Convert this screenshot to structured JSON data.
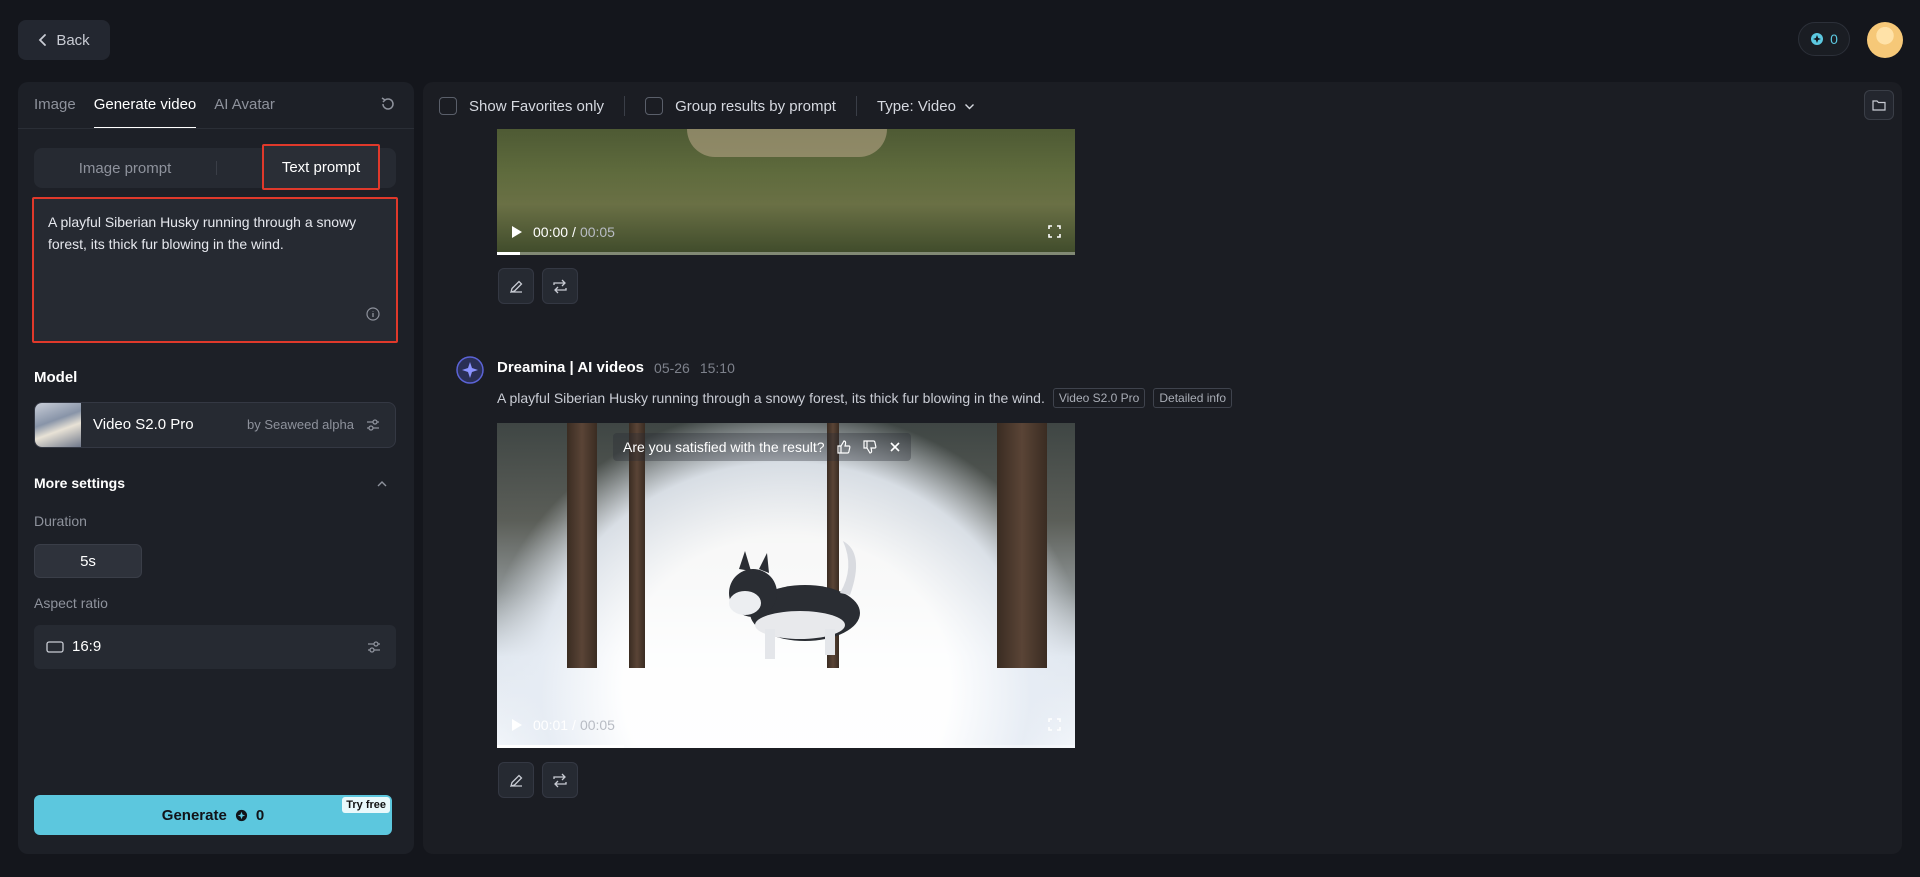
{
  "header": {
    "back_label": "Back",
    "credits": "0"
  },
  "sidebar": {
    "tabs": [
      {
        "label": "Image"
      },
      {
        "label": "Generate video"
      },
      {
        "label": "AI Avatar"
      }
    ],
    "prompt_modes": {
      "image": "Image prompt",
      "text": "Text prompt"
    },
    "prompt_text": "A playful Siberian Husky running through a snowy forest, its thick fur blowing in the wind.",
    "model_label": "Model",
    "model": {
      "name": "Video S2.0 Pro",
      "by": "by Seaweed alpha"
    },
    "more_settings_label": "More settings",
    "duration_label": "Duration",
    "duration_value": "5s",
    "aspect_label": "Aspect ratio",
    "aspect_value": "16:9",
    "generate_label": "Generate",
    "generate_cost": "0",
    "try_free": "Try free"
  },
  "filters": {
    "favorites": "Show Favorites only",
    "group": "Group results by prompt",
    "type": "Type: Video"
  },
  "results": [
    {
      "time_current": "00:00",
      "time_total": "00:05",
      "progress": 0.04
    },
    {
      "author": "Dreamina | AI videos",
      "date": "05-26",
      "time": "15:10",
      "prompt": "A playful Siberian Husky running through a snowy forest, its thick fur blowing in the wind.",
      "model_tag": "Video S2.0 Pro",
      "info_tag": "Detailed info",
      "feedback_question": "Are you satisfied with the result?",
      "time_current": "00:01",
      "time_total": "00:05",
      "progress": 0.22
    }
  ]
}
